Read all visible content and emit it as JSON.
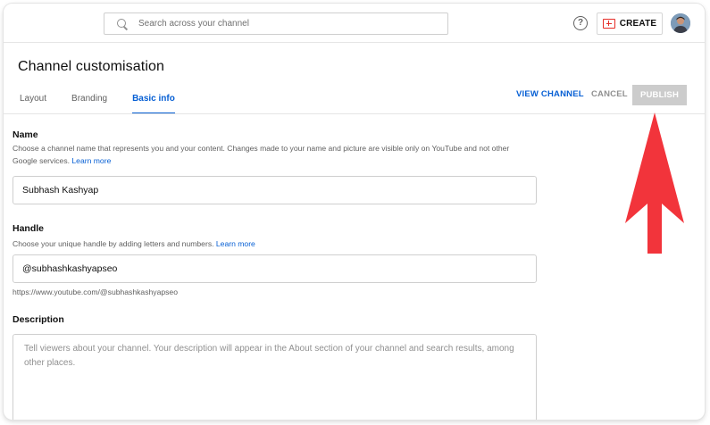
{
  "search": {
    "placeholder": "Search across your channel"
  },
  "topbar": {
    "help_label": "?",
    "create_label": "CREATE"
  },
  "page": {
    "title": "Channel customisation"
  },
  "tabs": [
    {
      "label": "Layout"
    },
    {
      "label": "Branding"
    },
    {
      "label": "Basic info"
    }
  ],
  "actions": {
    "view_channel": "VIEW CHANNEL",
    "cancel": "CANCEL",
    "publish": "PUBLISH"
  },
  "name_section": {
    "label": "Name",
    "description": "Choose a channel name that represents you and your content. Changes made to your name and picture are visible only on YouTube and not other Google services.",
    "learn_more": "Learn more",
    "value": "Subhash Kashyap"
  },
  "handle_section": {
    "label": "Handle",
    "description": "Choose your unique handle by adding letters and numbers.",
    "learn_more": "Learn more",
    "value": "@subhashkashyapseo",
    "url": "https://www.youtube.com/@subhashkashyapseo"
  },
  "description_section": {
    "label": "Description",
    "placeholder": "Tell viewers about your channel. Your description will appear in the About section of your channel and search results, among other places."
  },
  "colors": {
    "accent": "#065fd4",
    "arrow": "#f2343b",
    "publish_disabled": "#cccccc",
    "create_red": "#e52d27"
  },
  "icons": {
    "search": "search-icon",
    "help": "help-icon",
    "create": "create-video-icon",
    "arrow": "arrow-up-icon"
  }
}
